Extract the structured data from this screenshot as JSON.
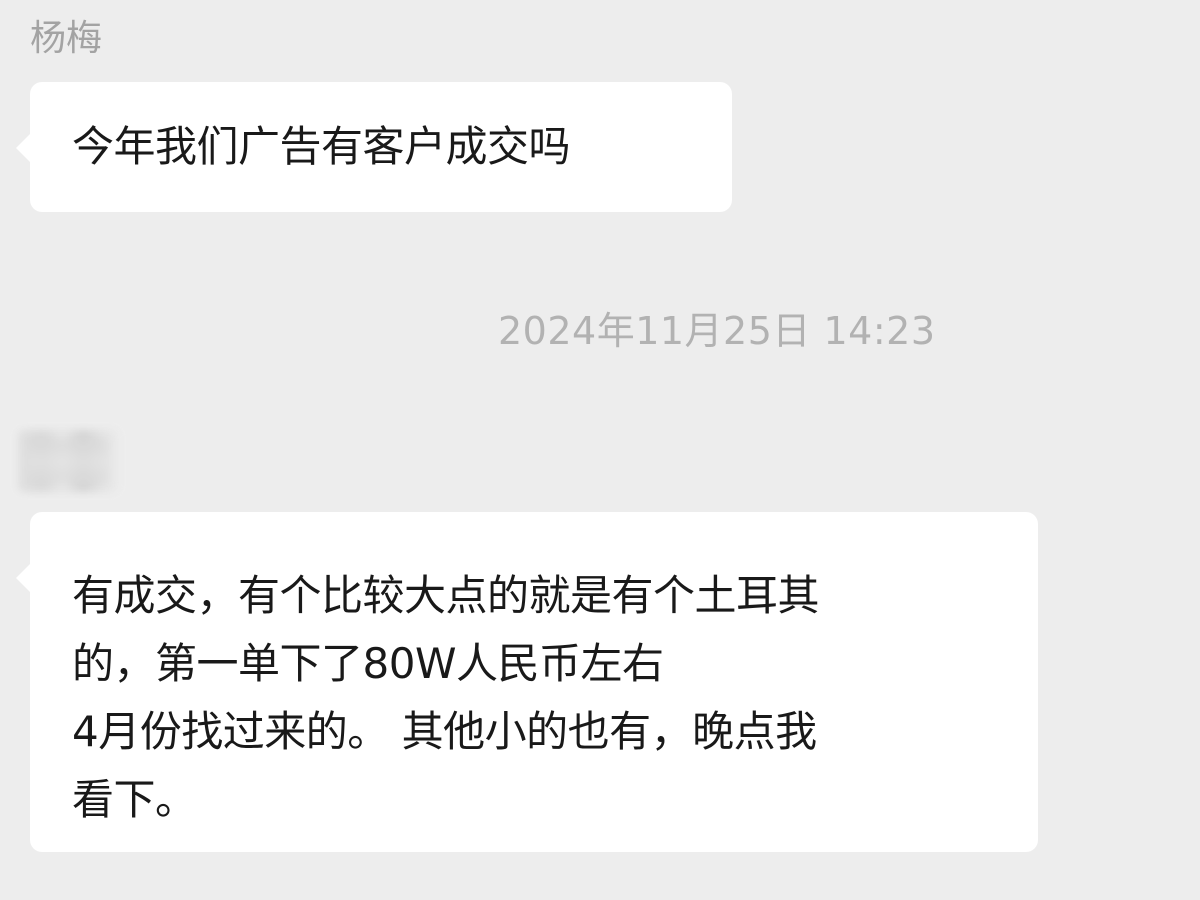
{
  "sender_name": "杨梅",
  "messages": [
    {
      "text": "今年我们广告有客户成交吗"
    },
    {
      "lines": [
        "有成交，有个比较大点的就是有个土耳其",
        "的，第一单下了80W人民币左右",
        "4月份找过来的。 其他小的也有，晚点我",
        "看下。"
      ]
    }
  ],
  "timestamp": "2024年11月25日 14:23"
}
